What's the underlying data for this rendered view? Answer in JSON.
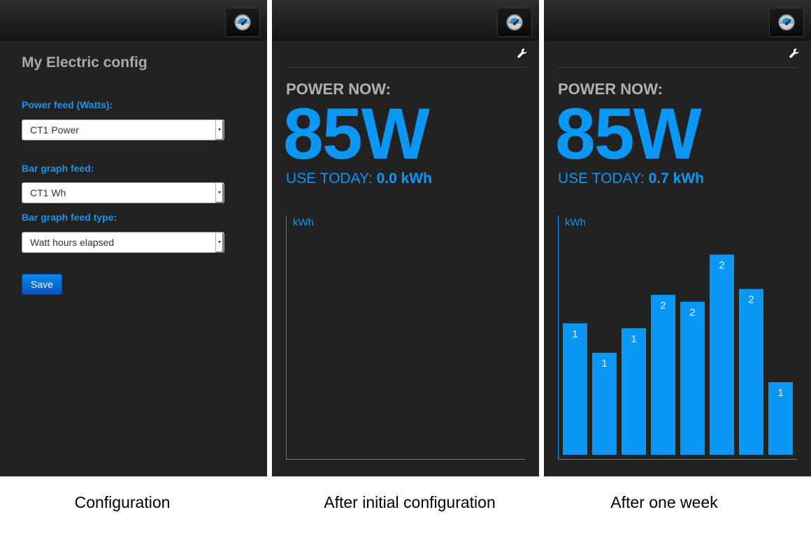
{
  "config_panel": {
    "title": "My Electric config",
    "power_feed_label": "Power feed (Watts):",
    "power_feed_value": "CT1 Power",
    "bar_feed_label": "Bar graph feed:",
    "bar_feed_value": "CT1 Wh",
    "bar_type_label": "Bar graph feed type:",
    "bar_type_value": "Watt hours elapsed",
    "save_label": "Save"
  },
  "initial_panel": {
    "power_now_label": "POWER NOW:",
    "power_now_value": "85W",
    "use_today_label": "USE TODAY:",
    "use_today_value": "0.0 kWh",
    "graph_unit": "kWh"
  },
  "week_panel": {
    "power_now_label": "POWER NOW:",
    "power_now_value": "85W",
    "use_today_label": "USE TODAY:",
    "use_today_value": "0.7 kWh",
    "graph_unit": "kWh"
  },
  "captions": {
    "config": "Configuration",
    "initial": "After initial configuration",
    "week": "After one week"
  },
  "colors": {
    "accent": "#0b98f4",
    "panel_bg": "#222222",
    "label_blue": "#1e93ea"
  },
  "icons": {
    "top_button": "dashboard-gauge-icon",
    "settings": "wrench-icon"
  },
  "chart_data": [
    {
      "type": "bar",
      "panel": "initial",
      "ylabel": "kWh",
      "values": []
    },
    {
      "type": "bar",
      "panel": "week",
      "ylabel": "kWh",
      "values": [
        1.34,
        1.04,
        1.29,
        1.63,
        1.56,
        2.04,
        1.69,
        0.74
      ],
      "data_labels": [
        "1",
        "1",
        "1",
        "2",
        "2",
        "2",
        "2",
        "1"
      ],
      "ylim": [
        0,
        2.25
      ]
    }
  ]
}
